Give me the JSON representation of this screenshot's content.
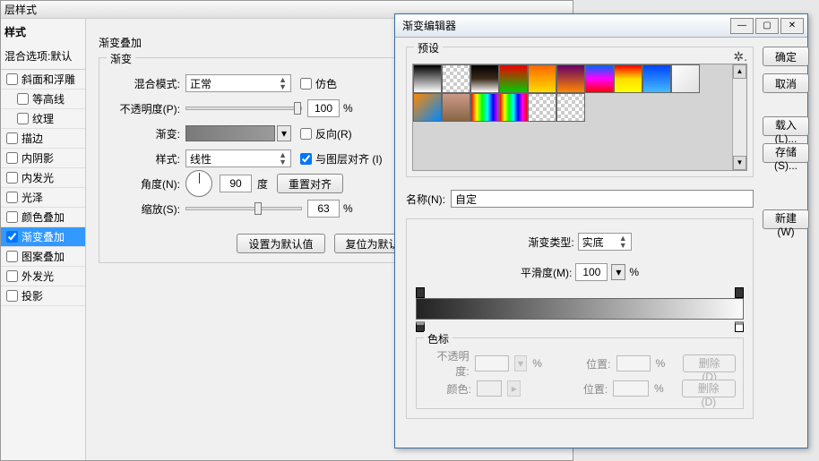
{
  "layerStyle": {
    "title": "层样式",
    "sidebar": {
      "header": "样式",
      "blending": "混合选项:默认",
      "items": [
        {
          "label": "斜面和浮雕",
          "checked": false
        },
        {
          "label": "等高线",
          "checked": false,
          "indent": true
        },
        {
          "label": "纹理",
          "checked": false,
          "indent": true
        },
        {
          "label": "描边",
          "checked": false
        },
        {
          "label": "内阴影",
          "checked": false
        },
        {
          "label": "内发光",
          "checked": false
        },
        {
          "label": "光泽",
          "checked": false
        },
        {
          "label": "颜色叠加",
          "checked": false
        },
        {
          "label": "渐变叠加",
          "checked": true,
          "selected": true
        },
        {
          "label": "图案叠加",
          "checked": false
        },
        {
          "label": "外发光",
          "checked": false
        },
        {
          "label": "投影",
          "checked": false
        }
      ]
    },
    "main": {
      "title": "渐变叠加",
      "groupTitle": "渐变",
      "blendMode": {
        "label": "混合模式:",
        "value": "正常"
      },
      "dither": "仿色",
      "opacity": {
        "label": "不透明度(P):",
        "value": "100",
        "pct": "%"
      },
      "gradient": {
        "label": "渐变:"
      },
      "reverse": "反向(R)",
      "style": {
        "label": "样式:",
        "value": "线性"
      },
      "alignWithLayer": "与图层对齐 (I)",
      "angle": {
        "label": "角度(N):",
        "value": "90",
        "unit": "度"
      },
      "resetAlign": "重置对齐",
      "scale": {
        "label": "缩放(S):",
        "value": "63",
        "pct": "%"
      },
      "setDefault": "设置为默认值",
      "resetDefault": "复位为默认值"
    }
  },
  "gradEditor": {
    "title": "渐变编辑器",
    "ok": "确定",
    "cancel": "取消",
    "load": "载入(L)...",
    "save": "存储(S)...",
    "presets": {
      "label": "预设"
    },
    "nameLabel": "名称(N):",
    "nameValue": "自定",
    "newBtn": "新建(W)",
    "typeLabel": "渐变类型:",
    "typeValue": "实底",
    "smoothLabel": "平滑度(M):",
    "smoothValue": "100",
    "pct": "%",
    "colorStops": {
      "title": "色标",
      "opacityLabel": "不透明度:",
      "positionLabel": "位置:",
      "colorLabel": "颜色:",
      "delete": "删除(D)"
    }
  },
  "chart_data": null
}
